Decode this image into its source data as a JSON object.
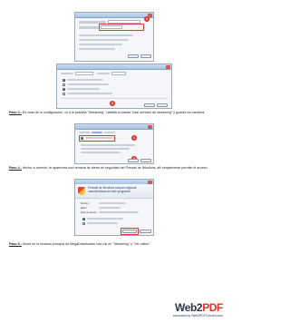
{
  "steps": [
    {
      "label": "Paso 3.-",
      "text": "En cuan de la configuración, ve a la pestaña \"Streaming\", habilita la casilla \"Usar servidor de streaming\" y guarda los cambios."
    },
    {
      "label": "Paso 4.-",
      "text": "Hecho lo anterior, te aparecerá una ventana de alerta de seguridad del Firewall de Windows, allí simplemente permite el acceso."
    },
    {
      "label": "Paso 5.-",
      "text": "Ahora en la ventana principal de MegaDownloader haz clic en \"Streaming\" y \"Ver online\"."
    }
  ],
  "callouts": {
    "one": "1",
    "two": "2"
  },
  "firewall_dialog": {
    "title": "Firewall de Windows bloqueó algunas características de este programa",
    "labels": [
      "Nombre:",
      "Editor:",
      "Ruta de acceso:"
    ],
    "button": "Permitir acceso"
  },
  "footer": {
    "logo_main": "Web2",
    "logo_accent": "PDF",
    "url": "converted by Web2PDFConvert.com"
  },
  "colors": {
    "callout": "#e0342b",
    "logo_dark": "#2a3550"
  }
}
